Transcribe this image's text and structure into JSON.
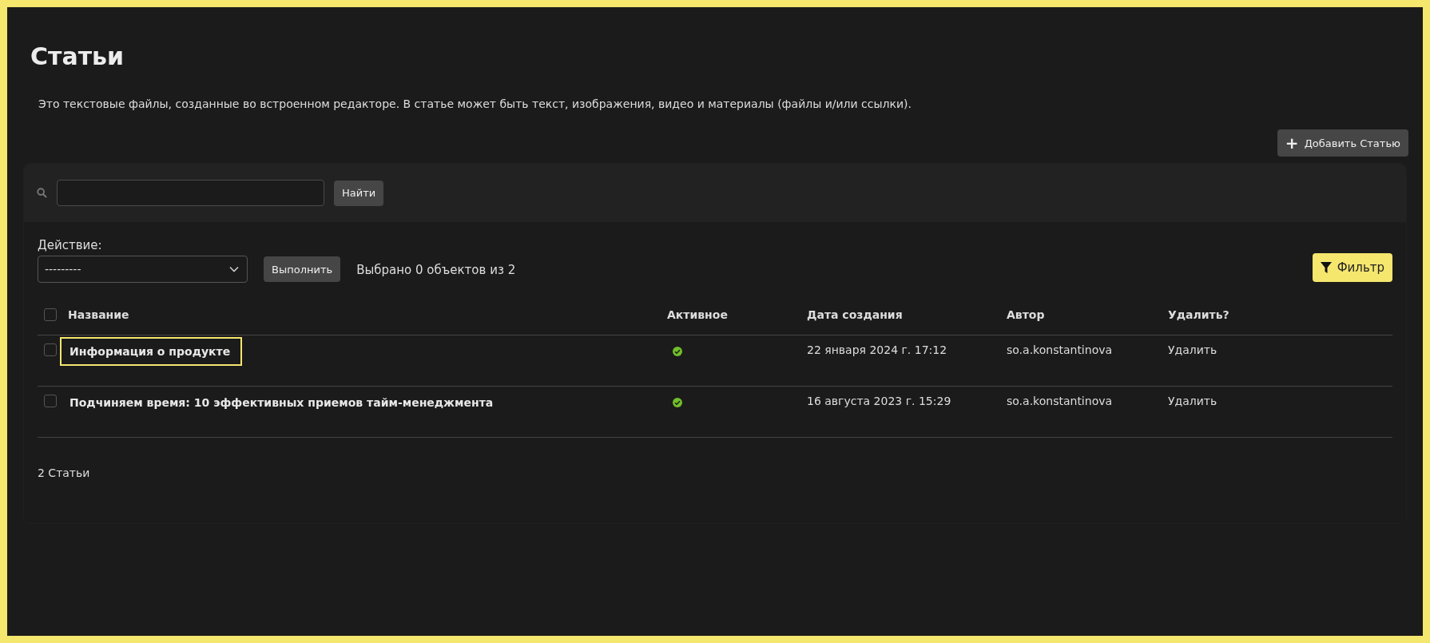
{
  "page": {
    "title": "Статьи",
    "description": "Это текстовые файлы, созданные во встроенном редакторе. В статье может быть текст, изображения, видео и материалы (файлы и/или ссылки)."
  },
  "add_button": {
    "icon": "+",
    "label": "Добавить Статью"
  },
  "search": {
    "button": "Найти"
  },
  "actions": {
    "label": "Действие:",
    "select_value": "---------",
    "run_button": "Выполнить",
    "selection_count": "Выбрано 0 объектов из 2"
  },
  "filter_button": {
    "label": "Фильтр"
  },
  "table": {
    "select_all_checked": false,
    "columns": [
      "Название",
      "Активное",
      "Дата создания",
      "Автор",
      "Удалить?"
    ],
    "rows": [
      {
        "checked": false,
        "focused": true,
        "title": "Информация о продукте",
        "active": true,
        "created": "22 января 2024 г. 17:12",
        "author": "so.a.konstantinova",
        "delete": "Удалить"
      },
      {
        "checked": false,
        "focused": false,
        "title": "Подчиняем время: 10 эффективных приемов тайм-менеджмента",
        "active": true,
        "created": "16 августа 2023 г. 15:29",
        "author": "so.a.konstantinova",
        "delete": "Удалить"
      }
    ]
  },
  "footer": {
    "count": "2 Статьи"
  }
}
